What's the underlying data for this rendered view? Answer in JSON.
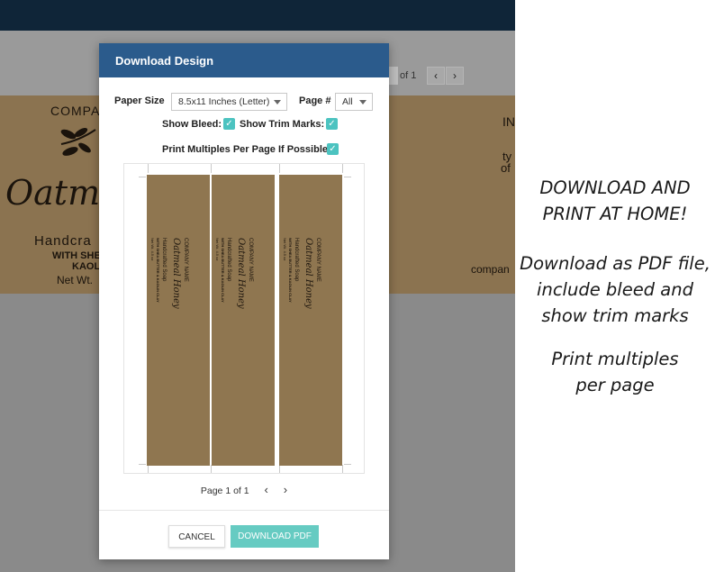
{
  "background": {
    "page_of": "of 1",
    "left_label": {
      "company": "COMPAN",
      "script": "Oatmea",
      "handcrafted": "Handcra",
      "with": "WITH SHE",
      "kaolin": "KAOLI",
      "net": "Net Wt."
    },
    "right_label": {
      "line1": "IN",
      "line2": "ty",
      "line3": "of",
      "company": "compan"
    },
    "colors": {
      "topbar": "#0f2538",
      "kraft": "#8b7350"
    }
  },
  "modal": {
    "title": "Download Design",
    "paper_size_label": "Paper Size",
    "paper_size_value": "8.5x11 Inches (Letter)",
    "page_num_label": "Page #",
    "page_num_value": "All",
    "show_bleed_label": "Show Bleed:",
    "show_bleed_checked": true,
    "show_trim_label": "Show Trim Marks:",
    "show_trim_checked": true,
    "print_multiples_label": "Print Multiples Per Page If Possible:",
    "print_multiples_checked": true,
    "pager_text": "Page 1 of 1",
    "cancel_label": "CANCEL",
    "download_label": "DOWNLOAD PDF",
    "strip": {
      "company": "COMPANY NAME",
      "script": "Oatmeal Honey",
      "handcrafted": "Handcrafted Soap",
      "with": "WITH SHEA BUTTER & KAOLIN CLAY",
      "net": "Net Wt. 4.5 oz"
    },
    "colors": {
      "header": "#2b5b8c",
      "accent": "#4cc3c0",
      "download": "#66cbc2"
    }
  },
  "annotations": {
    "heading_line1": "DOWNLOAD AND",
    "heading_line2": "PRINT AT HOME!",
    "p2_line1": "Download as PDF file,",
    "p2_line2": "include bleed and",
    "p2_line3": "show trim marks",
    "p3_line1": "Print multiples",
    "p3_line2": "per page"
  }
}
